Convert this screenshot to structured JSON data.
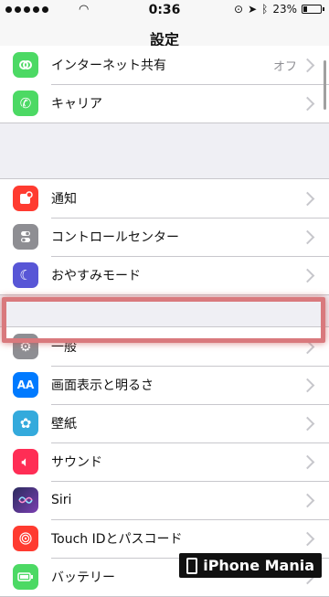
{
  "status": {
    "time": "0:36",
    "battery": "23%"
  },
  "nav": {
    "title": "設定"
  },
  "groups": [
    {
      "items": [
        {
          "label": "インターネット共有",
          "detail": "オフ",
          "icon": "link-icon",
          "color": "#4cd964"
        },
        {
          "label": "キャリア",
          "icon": "phone-icon",
          "color": "#4cd964"
        }
      ]
    },
    {
      "items": [
        {
          "label": "通知",
          "icon": "notification-icon",
          "color": "#ff3b30"
        },
        {
          "label": "コントロールセンター",
          "icon": "switch-icon",
          "color": "#8e8e93"
        },
        {
          "label": "おやすみモード",
          "icon": "moon-icon",
          "color": "#5856d6"
        }
      ]
    },
    {
      "items": [
        {
          "label": "一般",
          "icon": "gear-icon",
          "color": "#8e8e93"
        },
        {
          "label": "画面表示と明るさ",
          "icon": "text-size-icon",
          "color": "#007aff"
        },
        {
          "label": "壁紙",
          "icon": "flower-icon",
          "color": "#34aadc"
        },
        {
          "label": "サウンド",
          "icon": "speaker-icon",
          "color": "#ff2d55"
        },
        {
          "label": "Siri",
          "icon": "siri-icon",
          "color": "#2b2b5e"
        },
        {
          "label": "Touch IDとパスコード",
          "icon": "fingerprint-icon",
          "color": "#ff3b30"
        },
        {
          "label": "バッテリー",
          "icon": "battery-icon",
          "color": "#4cd964"
        }
      ]
    }
  ],
  "watermark": {
    "text": "iPhone Mania"
  }
}
